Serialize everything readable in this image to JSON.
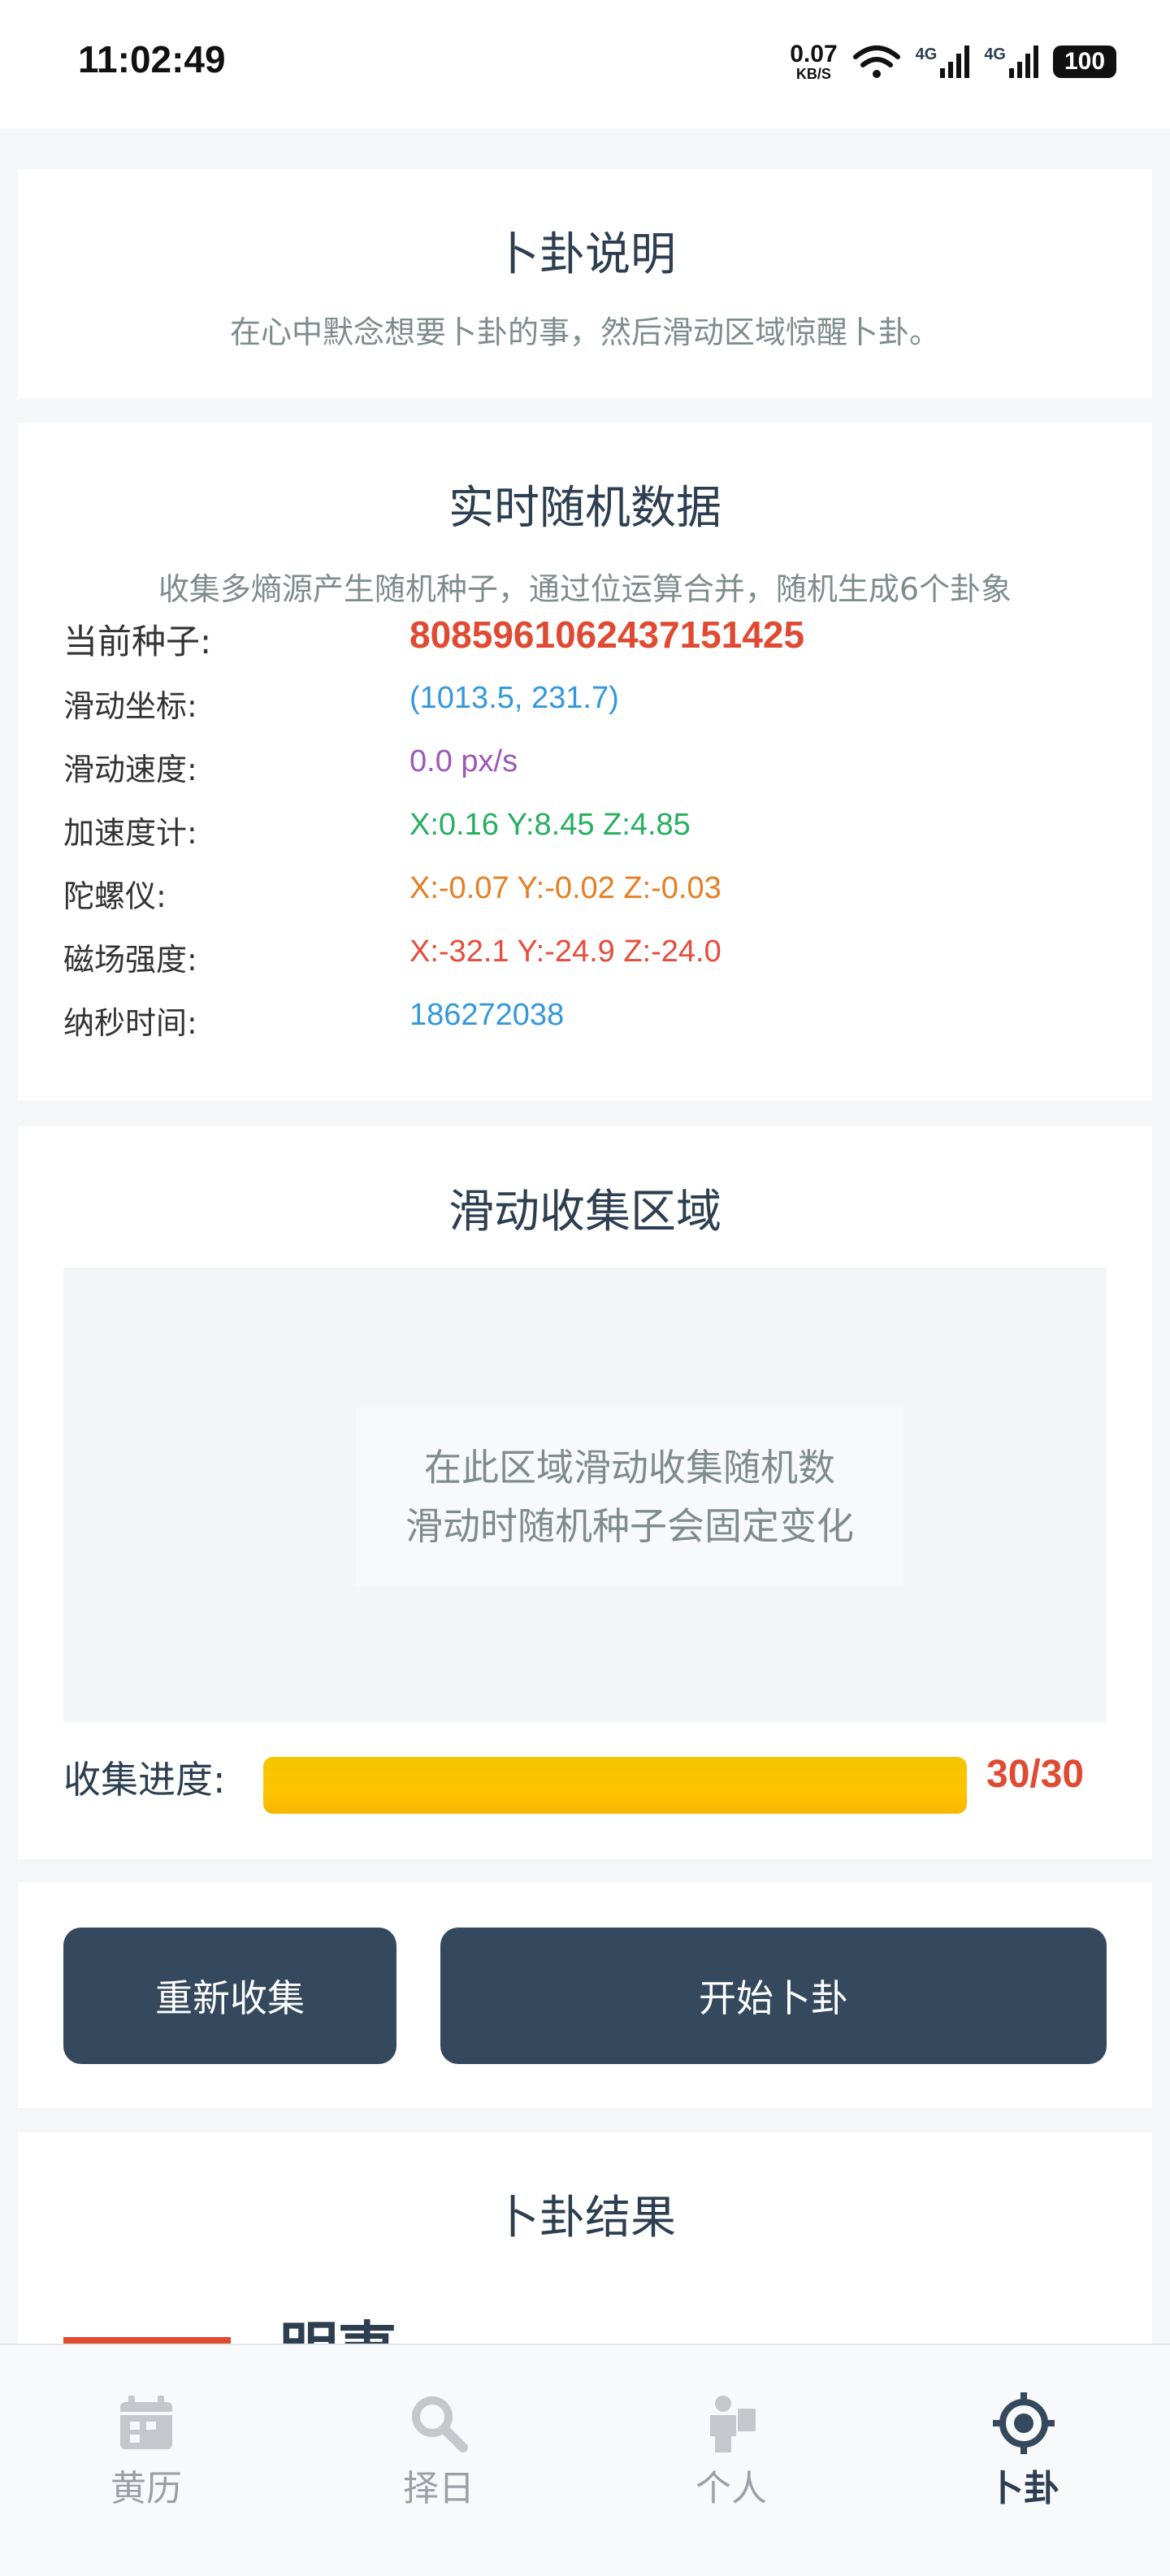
{
  "status_bar": {
    "time": "11:02:49",
    "net_speed_value": "0.07",
    "net_speed_unit": "KB/S",
    "signal_1": "4G",
    "signal_2": "4G",
    "battery": "100"
  },
  "instructions": {
    "title": "卜卦说明",
    "text": "在心中默念想要卜卦的事，然后滑动区域惊醒卜卦。"
  },
  "realtime": {
    "title": "实时随机数据",
    "subtitle": "收集多熵源产生随机种子，通过位运算合并，随机生成6个卦象",
    "rows": [
      {
        "label": "当前种子:",
        "value": "8085961062437151425",
        "color": "#e04a33"
      },
      {
        "label": "滑动坐标:",
        "value": "(1013.5, 231.7)",
        "color": "#3498db"
      },
      {
        "label": "滑动速度:",
        "value": "0.0 px/s",
        "color": "#9b59b6"
      },
      {
        "label": "加速度计:",
        "value": "X:0.16 Y:8.45 Z:4.85",
        "color": "#27ae60"
      },
      {
        "label": "陀螺仪:",
        "value": "X:-0.07 Y:-0.02 Z:-0.03",
        "color": "#e67e22"
      },
      {
        "label": "磁场强度:",
        "value": "X:-32.1 Y:-24.9 Z:-24.0",
        "color": "#e74c3c"
      },
      {
        "label": "纳秒时间:",
        "value": "186272038",
        "color": "#3498db"
      }
    ]
  },
  "swipe": {
    "title": "滑动收集区域",
    "hint_line1": "在此区域滑动收集随机数",
    "hint_line2": "滑动时随机种子会固定变化",
    "progress_label": "收集进度:",
    "progress_count": "30/30",
    "progress_fraction": 1.0
  },
  "actions": {
    "recollect": "重新收集",
    "start": "开始卜卦"
  },
  "result": {
    "title": "卜卦结果",
    "partial_text": "明夷"
  },
  "nav": {
    "items": [
      {
        "label": "黄历",
        "icon": "calendar-icon",
        "active": false
      },
      {
        "label": "择日",
        "icon": "search-icon",
        "active": false
      },
      {
        "label": "个人",
        "icon": "person-icon",
        "active": false
      },
      {
        "label": "卜卦",
        "icon": "compass-icon",
        "active": true
      }
    ],
    "active_color": "#2c3e50",
    "inactive_color": "#9aa0a6"
  }
}
